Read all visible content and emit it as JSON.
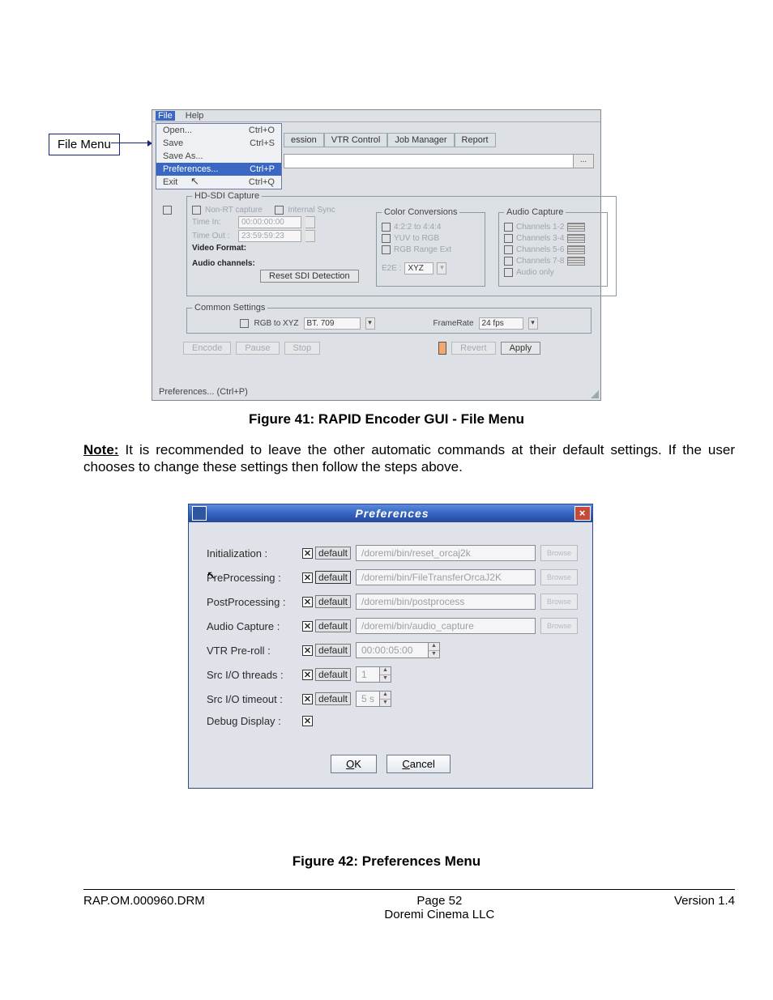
{
  "callout": "File Menu",
  "win1": {
    "menubar": {
      "file": "File",
      "help": "Help"
    },
    "filemenu": [
      {
        "l": "Open...",
        "s": "Ctrl+O"
      },
      {
        "l": "Save",
        "s": "Ctrl+S"
      },
      {
        "l": "Save As...",
        "s": ""
      },
      {
        "l": "Preferences...",
        "s": "Ctrl+P",
        "sel": true
      },
      {
        "l": "Exit",
        "s": "Ctrl+Q"
      }
    ],
    "toolbar": [
      "ession",
      "VTR Control",
      "Job Manager",
      "Report"
    ],
    "dot": "...",
    "hdcap": {
      "legend": "HD-SDI Capture",
      "nonrt": "Non-RT capture",
      "isync": "Internal Sync",
      "timein_l": "Time In:",
      "timein": "00:00:00:00",
      "timeout_l": "Time Out :",
      "timeout": "23:59:59:23",
      "vf": "Video Format:",
      "ac": "Audio channels:",
      "reset": "Reset SDI Detection"
    },
    "colorconv": {
      "legend": "Color Conversions",
      "a": "4:2:2 to 4:4:4",
      "b": "YUV to RGB",
      "c": "RGB Range Ext",
      "e2e": "E2E :",
      "xyz": "XYZ"
    },
    "audcap": {
      "legend": "Audio Capture",
      "c12": "Channels 1-2",
      "c34": "Channels 3-4",
      "c56": "Channels 5-6",
      "c78": "Channels 7-8",
      "only": "Audio only"
    },
    "common": {
      "legend": "Common Settings",
      "rgb": "RGB to XYZ",
      "bt": "BT. 709",
      "frl": "FrameRate",
      "fr": "24 fps"
    },
    "btns": {
      "enc": "Encode",
      "pause": "Pause",
      "stop": "Stop",
      "rev": "Revert",
      "apply": "Apply"
    },
    "status": "Preferences... (Ctrl+P)"
  },
  "fig1": "Figure 41: RAPID Encoder GUI - File Menu",
  "note_l": "Note:",
  "note": " It is recommended to leave the other automatic commands at their default settings. If the user chooses to change these settings then follow the steps above.",
  "win2": {
    "title": "Preferences",
    "rows": [
      {
        "l": "Initialization :",
        "v": "/doremi/bin/reset_orcaj2k",
        "b": true
      },
      {
        "l": "PreProcessing :",
        "v": "/doremi/bin/FileTransferOrcaJ2K",
        "b": true
      },
      {
        "l": "PostProcessing :",
        "v": "/doremi/bin/postprocess",
        "b": true
      },
      {
        "l": "Audio Capture :",
        "v": "/doremi/bin/audio_capture",
        "b": true
      }
    ],
    "vtr_l": "VTR Pre-roll :",
    "vtr_v": "00:00:05:00",
    "thr_l": "Src I/O threads :",
    "thr_v": "1",
    "tmo_l": "Src I/O timeout :",
    "tmo_v": "5 s",
    "dbg_l": "Debug Display :",
    "def": "default",
    "browse": "Browse",
    "ok": "OK",
    "cancel": "Cancel"
  },
  "fig2": "Figure 42: Preferences Menu",
  "footer": {
    "l": "RAP.OM.000960.DRM",
    "c1": "Page ",
    "c2": "52",
    "c3": "Doremi Cinema LLC",
    "r": "Version 1.4"
  }
}
